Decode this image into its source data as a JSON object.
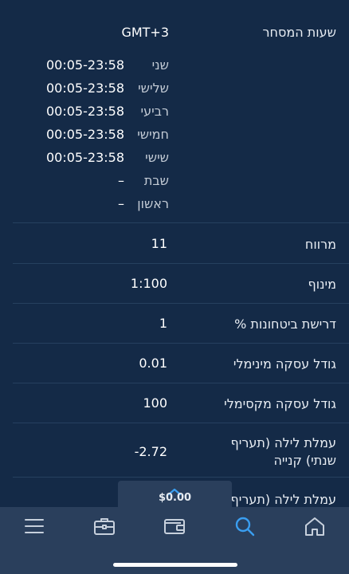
{
  "trading_hours": {
    "label": "שעות המסחר",
    "timezone": "GMT+3",
    "days": [
      {
        "day": "שני",
        "hours": "00:05-23:58"
      },
      {
        "day": "שלישי",
        "hours": "00:05-23:58"
      },
      {
        "day": "רביעי",
        "hours": "00:05-23:58"
      },
      {
        "day": "חמישי",
        "hours": "00:05-23:58"
      },
      {
        "day": "שישי",
        "hours": "00:05-23:58"
      },
      {
        "day": "שבת",
        "hours": "–"
      },
      {
        "day": "ראשון",
        "hours": "–"
      }
    ]
  },
  "specs": [
    {
      "label": "מרווח",
      "value": "11"
    },
    {
      "label": "מינוף",
      "value": "1:100"
    },
    {
      "label": "דרישת ביטחונות %",
      "value": "1"
    },
    {
      "label": "גודל עסקה מינימלי",
      "value": "0.01"
    },
    {
      "label": "גודל עסקה מקסימלי",
      "value": "100"
    },
    {
      "label_line1": "עמלת לילה (תעריף",
      "label_line2": "שנתי) קנייה",
      "value": "-2.72"
    },
    {
      "label_line1": "עמלת לילה (תעריף"
    }
  ],
  "balance": {
    "amount": "$0.00"
  },
  "tabbar": {
    "items": [
      {
        "icon": "menu-icon"
      },
      {
        "icon": "briefcase-icon"
      },
      {
        "icon": "wallet-icon"
      },
      {
        "icon": "search-icon",
        "active": true
      },
      {
        "icon": "home-icon"
      }
    ]
  },
  "colors": {
    "background": "#142a47",
    "tabbar": "#2a3f5c",
    "accent": "#3a9ef0"
  }
}
